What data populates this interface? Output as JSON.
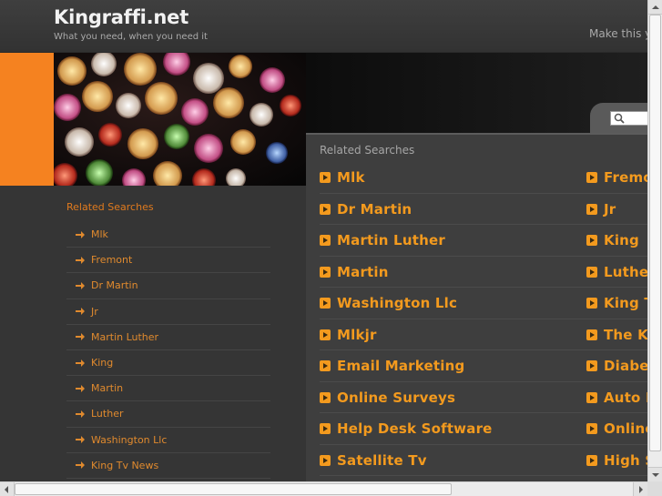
{
  "header": {
    "site_title": "Kingraffi.net",
    "tagline": "What you need, when you need it",
    "right_text": "Make this y"
  },
  "sidebar": {
    "heading": "Related Searches",
    "items": [
      "Mlk",
      "Fremont",
      "Dr Martin",
      "Jr",
      "Martin Luther",
      "King",
      "Martin",
      "Luther",
      "Washington Llc",
      "King Tv News"
    ]
  },
  "panel": {
    "heading": "Related Searches",
    "rows": [
      {
        "left": "Mlk",
        "right": "Fremo"
      },
      {
        "left": "Dr Martin",
        "right": "Jr"
      },
      {
        "left": "Martin Luther",
        "right": "King"
      },
      {
        "left": "Martin",
        "right": "Luther"
      },
      {
        "left": "Washington Llc",
        "right": "King T"
      },
      {
        "left": "Mlkjr",
        "right": "The Ki"
      },
      {
        "left": "Email Marketing",
        "right": "Diabet"
      },
      {
        "left": "Online Surveys",
        "right": "Auto I"
      },
      {
        "left": "Help Desk Software",
        "right": "Online"
      },
      {
        "left": "Satellite Tv",
        "right": "High S"
      }
    ]
  },
  "colors": {
    "accent_orange": "#f39a1e",
    "sidebar_orange": "#e08a2e",
    "banner_strip": "#f58220",
    "background": "#353535"
  }
}
